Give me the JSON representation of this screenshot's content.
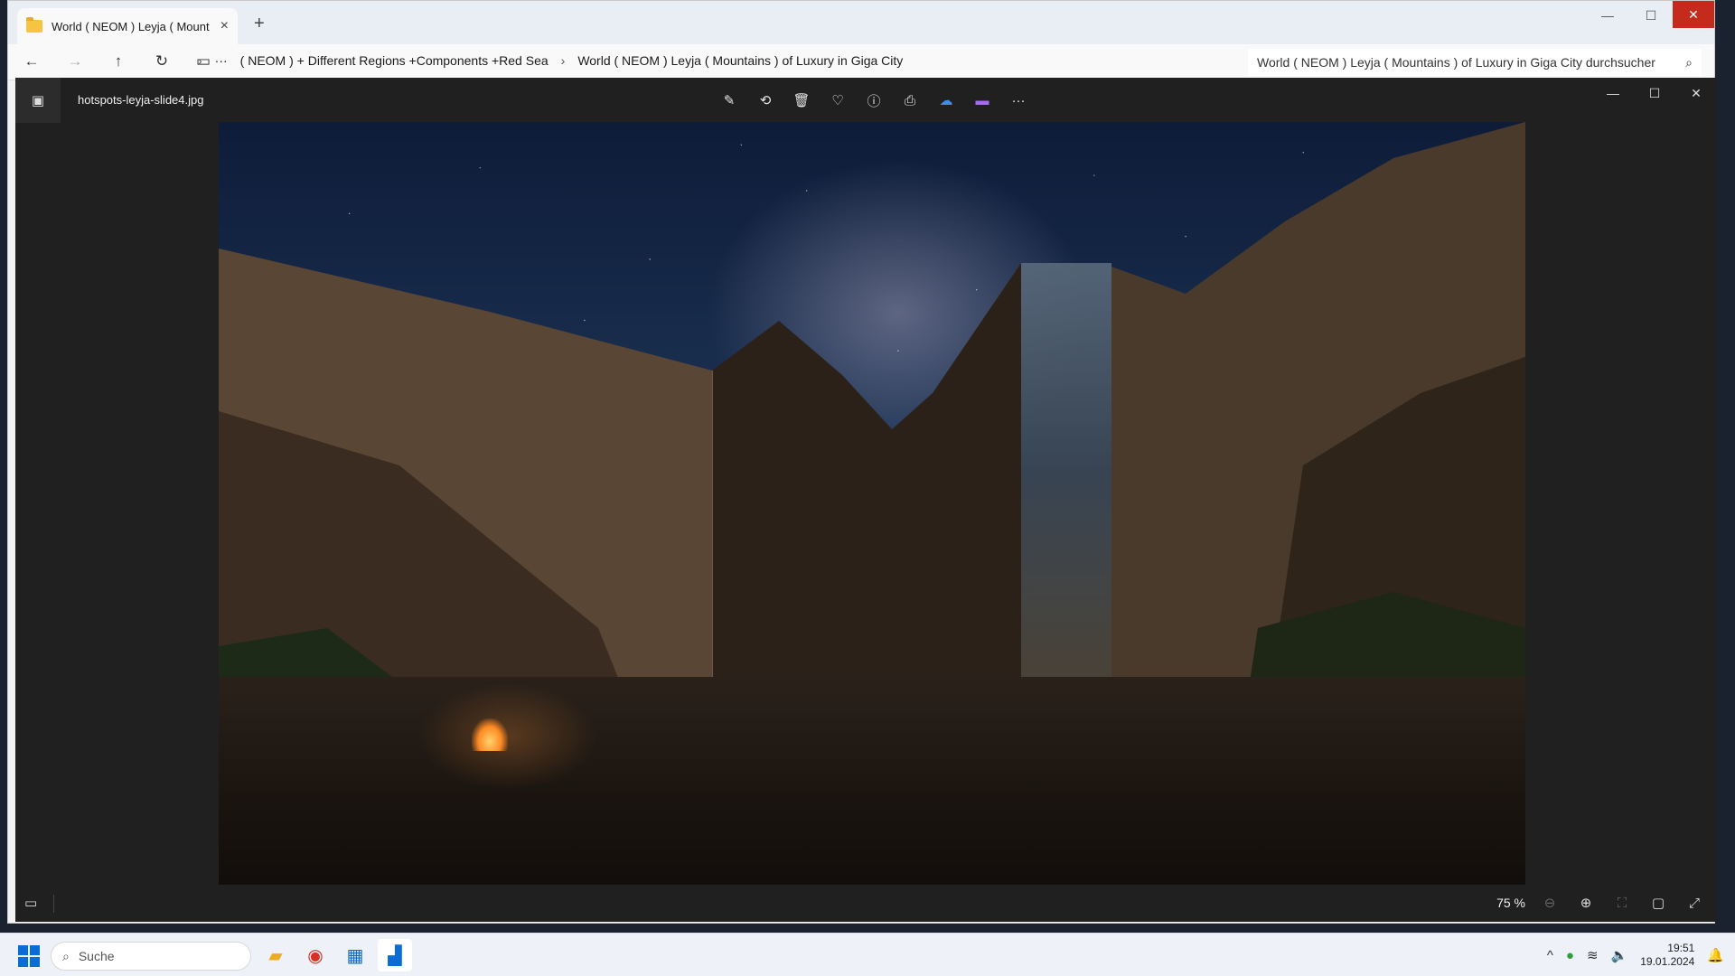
{
  "explorer": {
    "tab_title": "World ( NEOM ) Leyja ( Mount",
    "breadcrumbs": [
      "( NEOM ) + Different Regions +Components +Red Sea",
      "World ( NEOM ) Leyja ( Mountains ) of Luxury in Giga City"
    ],
    "search_text": "World ( NEOM ) Leyja ( Mountains ) of Luxury in Giga City durchsucher"
  },
  "viewer": {
    "file_name": "hotspots-leyja-slide4.jpg",
    "toolbar_icons": [
      "edit-icon",
      "rotate-icon",
      "delete-icon",
      "favorite-icon",
      "info-icon",
      "print-icon",
      "onedrive-icon",
      "clipchamp-icon",
      "more-icon"
    ],
    "zoom": "75 %"
  },
  "taskbar": {
    "search_placeholder": "Suche",
    "time": "19:51",
    "date": "19.01.2024"
  },
  "colors": {
    "accent": "#0a6cd4",
    "close_red": "#c42b1c",
    "viewer_bg": "#202020"
  }
}
